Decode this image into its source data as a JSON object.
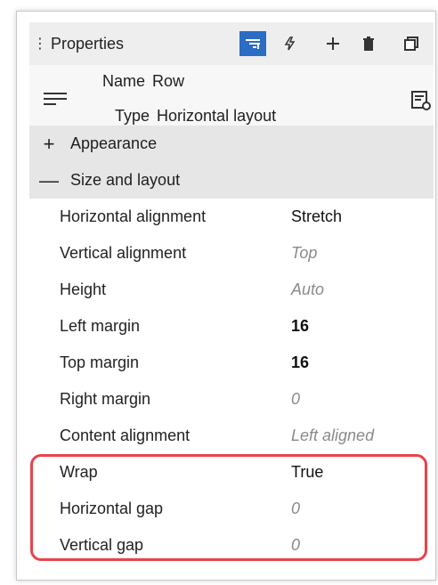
{
  "toolbar": {
    "grip_glyph": "⋮",
    "title": "Properties",
    "buttons": [
      {
        "name": "properties-tab-button",
        "icon": "list-filter-icon",
        "glyph": "☰",
        "active": true
      },
      {
        "name": "events-tab-button",
        "icon": "lightning-icon",
        "glyph": "ϟ",
        "active": false
      },
      {
        "name": "add-button",
        "icon": "plus-icon",
        "glyph": "+",
        "active": false
      },
      {
        "name": "delete-button",
        "icon": "trash-icon",
        "glyph": "🗑",
        "active": false
      },
      {
        "name": "copy-button",
        "icon": "copy-icon",
        "glyph": "⧉",
        "active": false
      }
    ]
  },
  "summary": {
    "name_label": "Name",
    "name_value": "Row",
    "type_label": "Type",
    "type_value": "Horizontal layout"
  },
  "sections": {
    "appearance": {
      "sign": "+",
      "label": "Appearance"
    },
    "size_layout": {
      "sign": "—",
      "label": "Size and layout"
    }
  },
  "properties": [
    {
      "label": "Horizontal alignment",
      "value": "Stretch",
      "style": "set"
    },
    {
      "label": "Vertical alignment",
      "value": "Top",
      "style": "default"
    },
    {
      "label": "Height",
      "value": "Auto",
      "style": "default"
    },
    {
      "label": "Left margin",
      "value": "16",
      "style": "bold"
    },
    {
      "label": "Top margin",
      "value": "16",
      "style": "bold"
    },
    {
      "label": "Right margin",
      "value": "0",
      "style": "default"
    },
    {
      "label": "Content alignment",
      "value": "Left aligned",
      "style": "default"
    },
    {
      "label": "Wrap",
      "value": "True",
      "style": "set"
    },
    {
      "label": "Horizontal gap",
      "value": "0",
      "style": "default"
    },
    {
      "label": "Vertical gap",
      "value": "0",
      "style": "default"
    }
  ],
  "colors": {
    "active_button": "#2b6cc4",
    "highlight": "#e8434b",
    "section_bg": "#e6e6e6",
    "default_value_text": "#8a8a8a"
  }
}
